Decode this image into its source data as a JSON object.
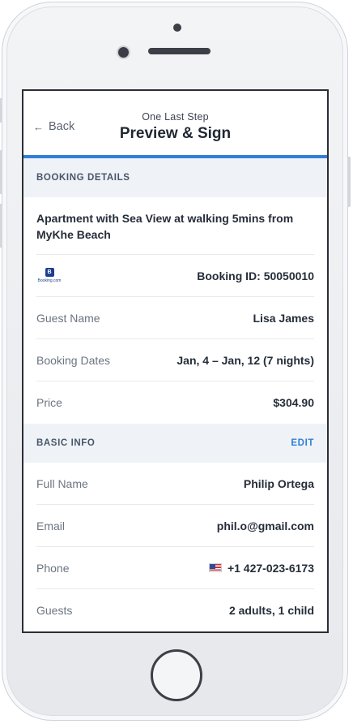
{
  "header": {
    "back_label": "Back",
    "back_icon": "arrow-left-icon",
    "subtitle": "One Last Step",
    "title": "Preview & Sign",
    "accent_color": "#2f80d6"
  },
  "booking_details": {
    "section_title": "BOOKING DETAILS",
    "property_name": "Apartment with Sea View at walking 5mins from MyKhe Beach",
    "provider_logo": {
      "letter": "B",
      "text": "Booking.com"
    },
    "booking_id": "Booking ID: 50050010",
    "rows": [
      {
        "label": "Guest Name",
        "value": "Lisa James"
      },
      {
        "label": "Booking Dates",
        "value": "Jan, 4 – Jan, 12 (7 nights)"
      },
      {
        "label": "Price",
        "value": "$304.90"
      }
    ]
  },
  "basic_info": {
    "section_title": "BASIC INFO",
    "edit_label": "EDIT",
    "rows": [
      {
        "label": "Full Name",
        "value": "Philip Ortega"
      },
      {
        "label": "Email",
        "value": "phil.o@gmail.com"
      },
      {
        "label": "Phone",
        "value": "+1 427-023-6173",
        "icon": "us-flag-icon"
      },
      {
        "label": "Guests",
        "value": "2 adults, 1 child"
      }
    ]
  }
}
